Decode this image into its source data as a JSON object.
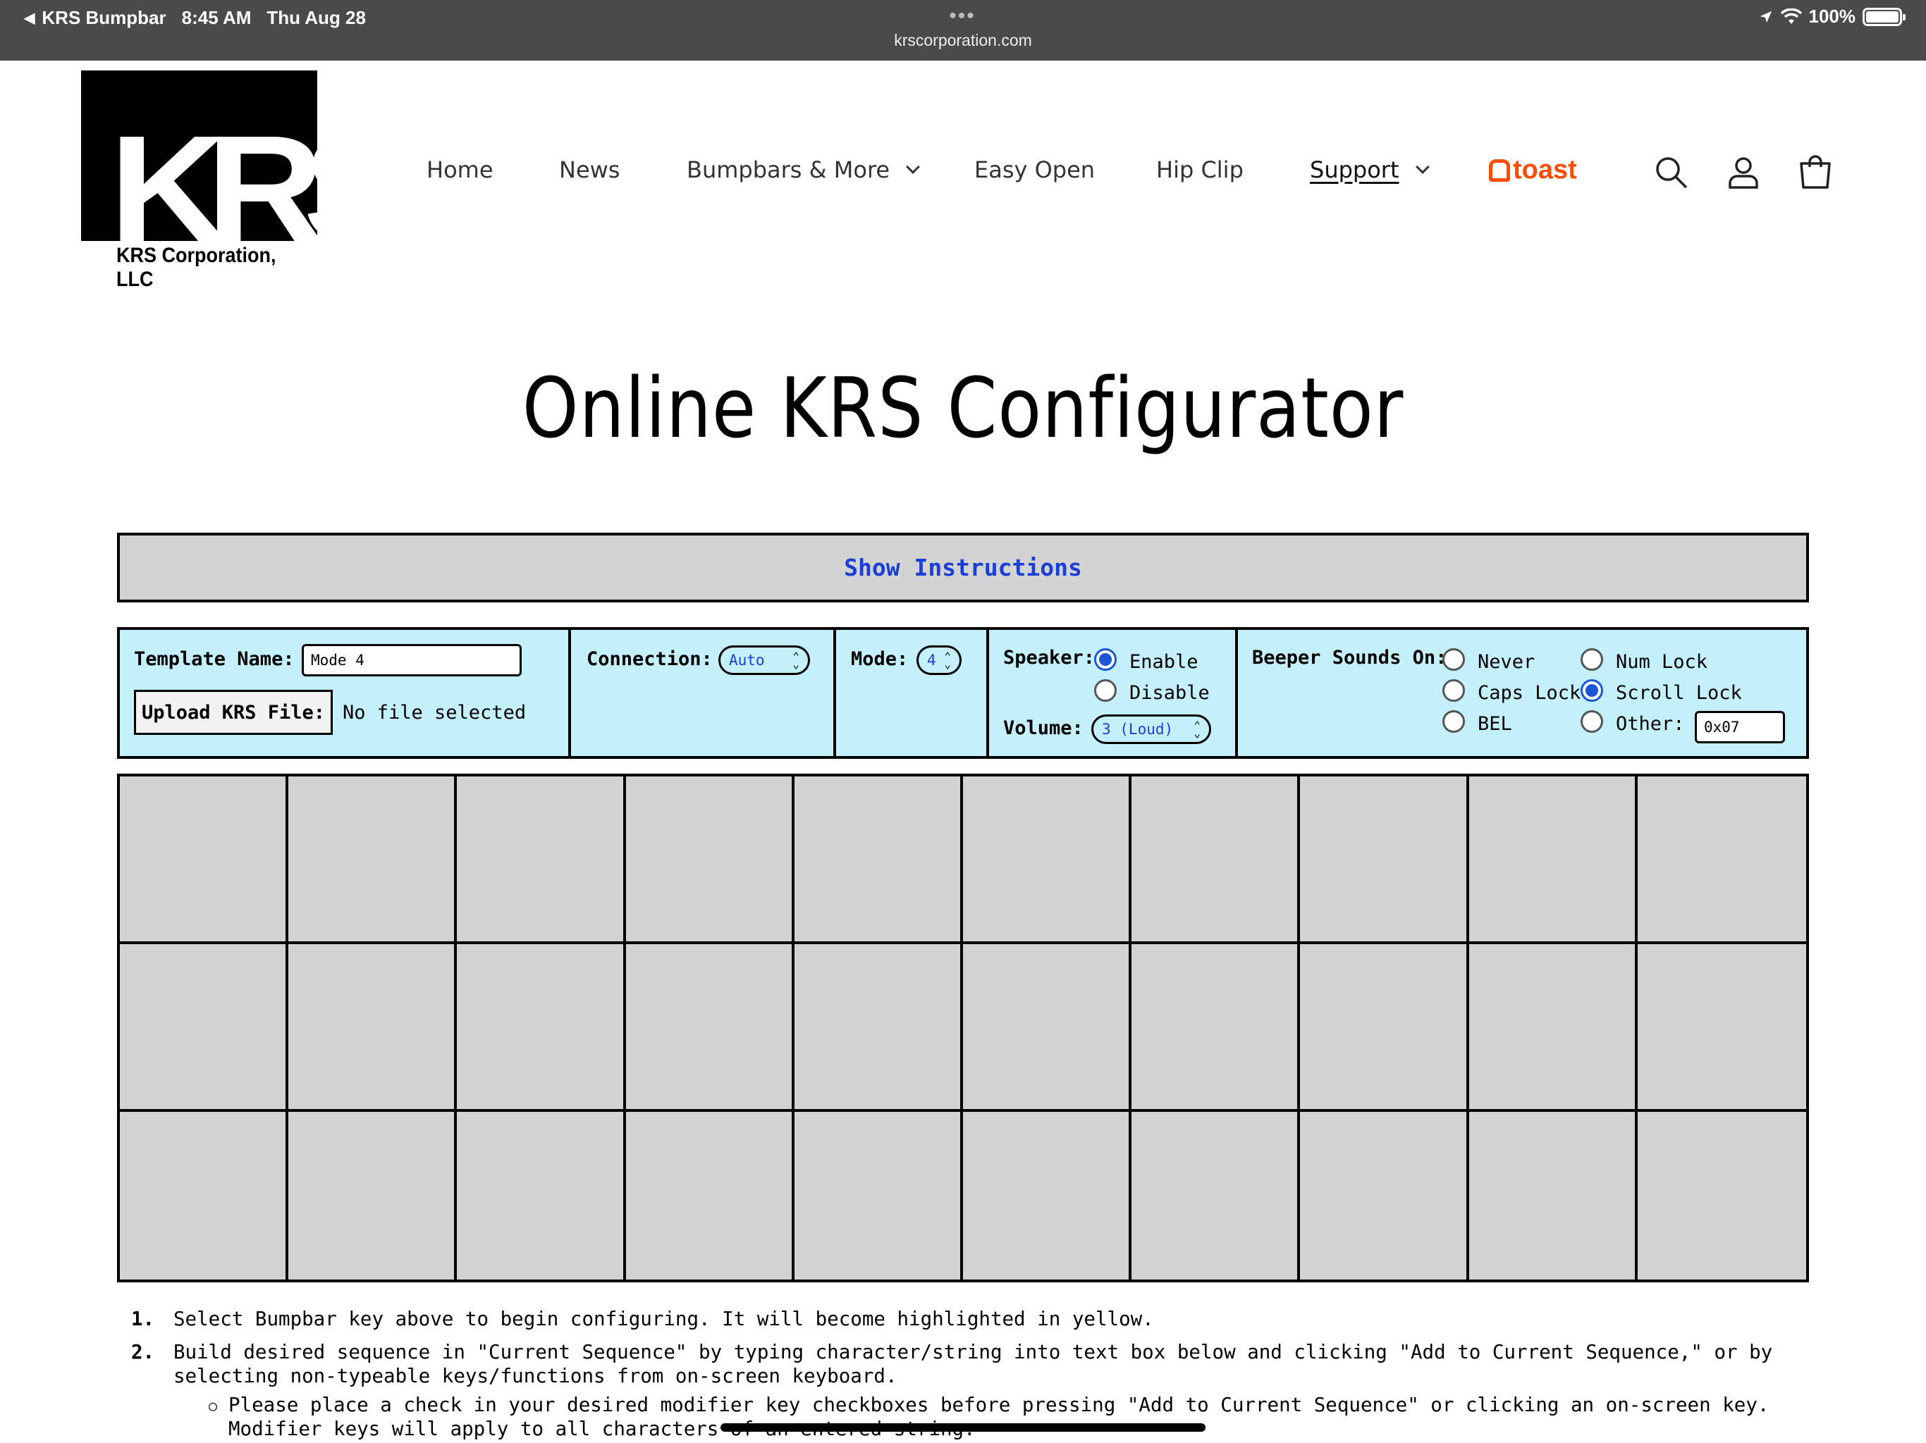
{
  "status_bar": {
    "back_app": "KRS Bumpbar",
    "time": "8:45 AM",
    "date": "Thu Aug 28",
    "url": "krscorporation.com",
    "battery": "100%"
  },
  "logo": {
    "letters": "KRS",
    "corp_name": "KRS Corporation, LLC"
  },
  "nav": {
    "items": [
      {
        "label": "Home"
      },
      {
        "label": "News"
      },
      {
        "label": "Bumpbars & More"
      },
      {
        "label": "Easy Open"
      },
      {
        "label": "Hip Clip"
      },
      {
        "label": "Support"
      }
    ],
    "toast_label": "toast",
    "active": "Support"
  },
  "page_title": "Online KRS Configurator",
  "instructions_toggle": "Show Instructions",
  "config": {
    "template_name_label": "Template Name:",
    "template_name_value": "Mode 4",
    "upload_button": "Upload KRS File:",
    "upload_status": "No file selected",
    "connection_label": "Connection:",
    "connection_value": "Auto",
    "mode_label": "Mode:",
    "mode_value": "4",
    "speaker_label": "Speaker:",
    "speaker_options": [
      "Enable",
      "Disable"
    ],
    "speaker_selected": "Enable",
    "volume_label": "Volume:",
    "volume_value": "3 (Loud)",
    "beeper_label": "Beeper Sounds On:",
    "beeper_options": [
      "Never",
      "Num Lock",
      "Caps Lock",
      "Scroll Lock",
      "BEL",
      "Other:"
    ],
    "beeper_selected": "Scroll Lock",
    "other_value": "0x07"
  },
  "key_grid": {
    "rows": 3,
    "columns": 10
  },
  "steps": [
    {
      "num": "1.",
      "text": "Select Bumpbar key above to begin configuring. It will become highlighted in yellow."
    },
    {
      "num": "2.",
      "text": "Build desired sequence in \"Current Sequence\" by typing character/string into text box below and clicking \"Add to Current Sequence,\" or by selecting non-typeable keys/functions from on-screen keyboard."
    }
  ],
  "sub_steps": [
    {
      "text": "Please place a check in your desired modifier key checkboxes before pressing \"Add to Current Sequence\" or clicking an on-screen key. Modifier keys will apply to all characters of an entered string."
    }
  ],
  "colors": {
    "status_bar": "#4a4a4a",
    "config_bg": "#c4f0fb",
    "grid_bg": "#d3d3d3",
    "link_blue": "#1a3fd6",
    "toast_orange": "#ff4c00"
  }
}
